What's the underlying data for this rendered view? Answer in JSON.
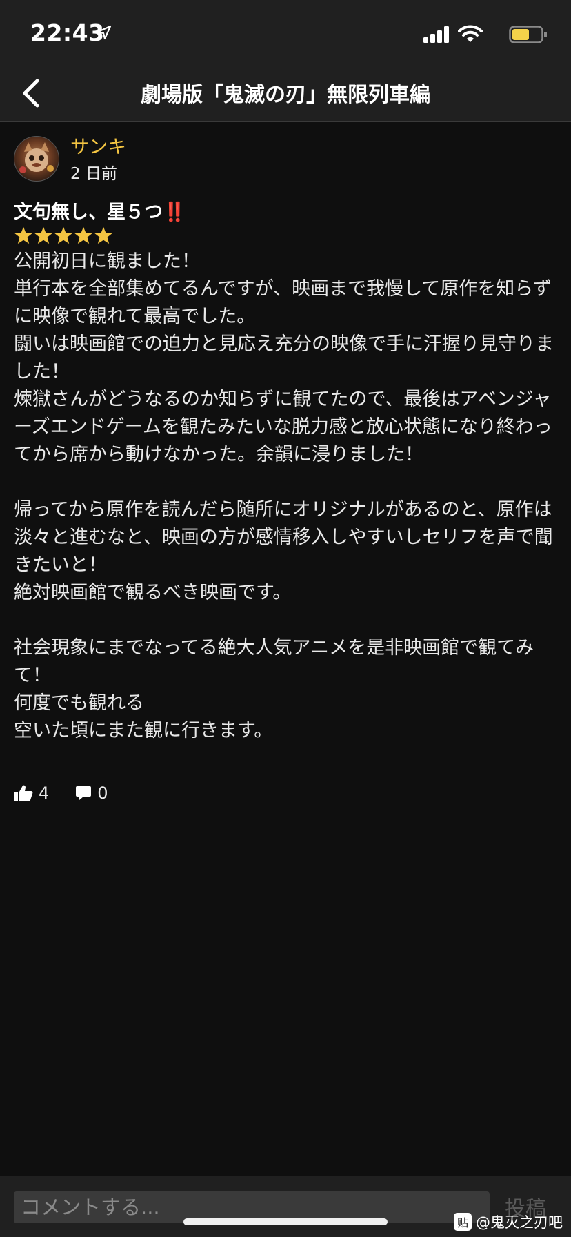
{
  "status_bar": {
    "time": "22:43",
    "icons": [
      "location-arrow-icon",
      "cellular-signal-icon",
      "wifi-icon",
      "battery-icon"
    ],
    "battery_color": "#f4d24a"
  },
  "nav": {
    "title": "劇場版「鬼滅の刃」無限列車編",
    "back_icon": "chevron-left-icon"
  },
  "review": {
    "author": "サンキ",
    "date": "2 日前",
    "title": "文句無し、星５つ",
    "title_emoji": "‼️",
    "rating": 5,
    "rating_max": 5,
    "body": "公開初日に観ました！\n単行本を全部集めてるんですが、映画まで我慢して原作を知らずに映像で観れて最高でした。\n闘いは映画館での迫力と見応え充分の映像で手に汗握り見守りました！\n煉獄さんがどうなるのか知らずに観てたので、最後はアベンジャーズエンドゲームを観たみたいな脱力感と放心状態になり終わってから席から動けなかった。余韻に浸りました！\n\n帰ってから原作を読んだら随所にオリジナルがあるのと、原作は淡々と進むなと、映画の方が感情移入しやすいしセリフを声で聞きたいと！\n絶対映画館で観るべき映画です。\n\n社会現象にまでなってる絶大人気アニメを是非映画館で観てみて！\n何度でも観れる\n空いた頃にまた観に行きます。",
    "likes": "4",
    "comments": "0"
  },
  "comment_bar": {
    "placeholder": "コメントする...",
    "post_label": "投稿"
  },
  "watermark": {
    "logo": "贴",
    "text": "@鬼灭之刃吧"
  },
  "colors": {
    "background": "#0f0f0f",
    "bar": "#202020",
    "author": "#f4c542",
    "star": "#f4c542"
  }
}
